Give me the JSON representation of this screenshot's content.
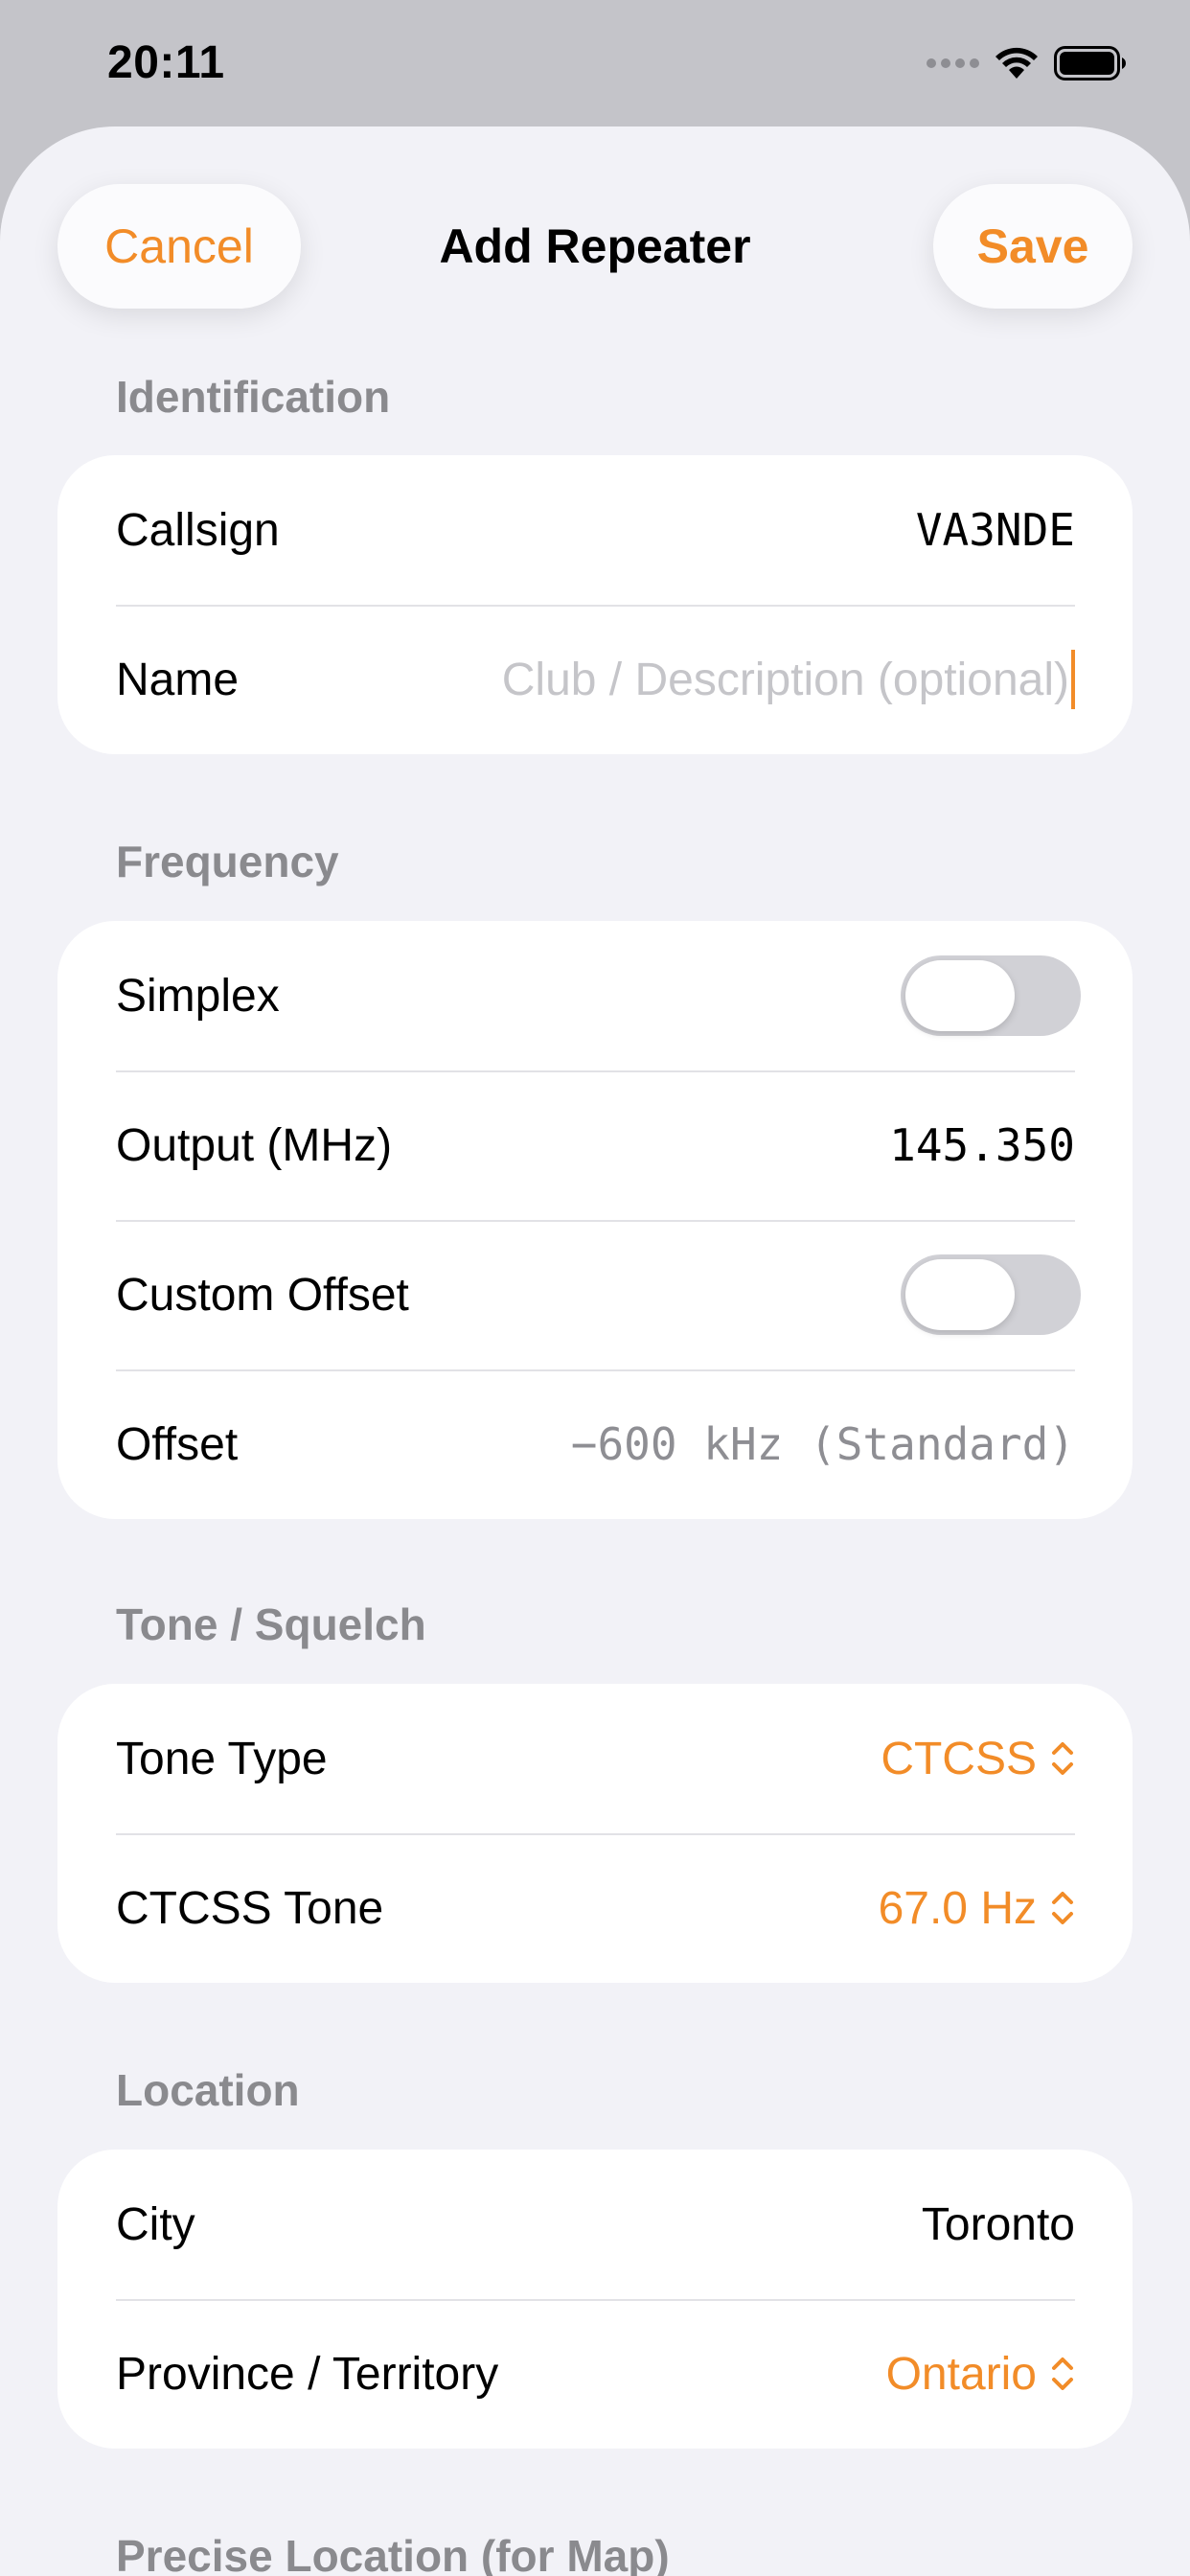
{
  "status": {
    "time": "20:11"
  },
  "nav": {
    "cancel": "Cancel",
    "title": "Add Repeater",
    "save": "Save"
  },
  "sections": {
    "identification": {
      "header": "Identification",
      "callsign_label": "Callsign",
      "callsign_value": "VA3NDE",
      "name_label": "Name",
      "name_placeholder": "Club / Description (optional)"
    },
    "frequency": {
      "header": "Frequency",
      "simplex_label": "Simplex",
      "simplex_on": false,
      "output_label": "Output (MHz)",
      "output_value": "145.350",
      "custom_offset_label": "Custom Offset",
      "custom_offset_on": false,
      "offset_label": "Offset",
      "offset_value": "−600 kHz (Standard)"
    },
    "tone": {
      "header": "Tone / Squelch",
      "tone_type_label": "Tone Type",
      "tone_type_value": "CTCSS",
      "ctcss_label": "CTCSS Tone",
      "ctcss_value": "67.0 Hz"
    },
    "location": {
      "header": "Location",
      "city_label": "City",
      "city_value": "Toronto",
      "province_label": "Province / Territory",
      "province_value": "Ontario"
    },
    "precise": {
      "header": "Precise Location (for Map)"
    }
  },
  "colors": {
    "accent": "#f28c28",
    "background": "#f2f2f7",
    "card": "#ffffff",
    "secondary": "#8a8a8e"
  }
}
